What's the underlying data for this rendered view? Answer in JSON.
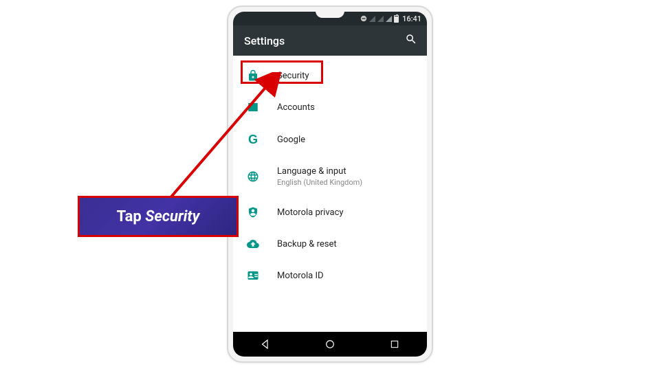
{
  "status": {
    "time": "16:41"
  },
  "appbar": {
    "title": "Settings"
  },
  "items": [
    {
      "label": "Security",
      "sub": ""
    },
    {
      "label": "Accounts",
      "sub": ""
    },
    {
      "label": "Google",
      "sub": ""
    },
    {
      "label": "Language & input",
      "sub": "English (United Kingdom)"
    },
    {
      "label": "Motorola privacy",
      "sub": ""
    },
    {
      "label": "Backup & reset",
      "sub": ""
    },
    {
      "label": "Motorola ID",
      "sub": ""
    }
  ],
  "callout": {
    "prefix": "Tap ",
    "emph": "Security"
  }
}
